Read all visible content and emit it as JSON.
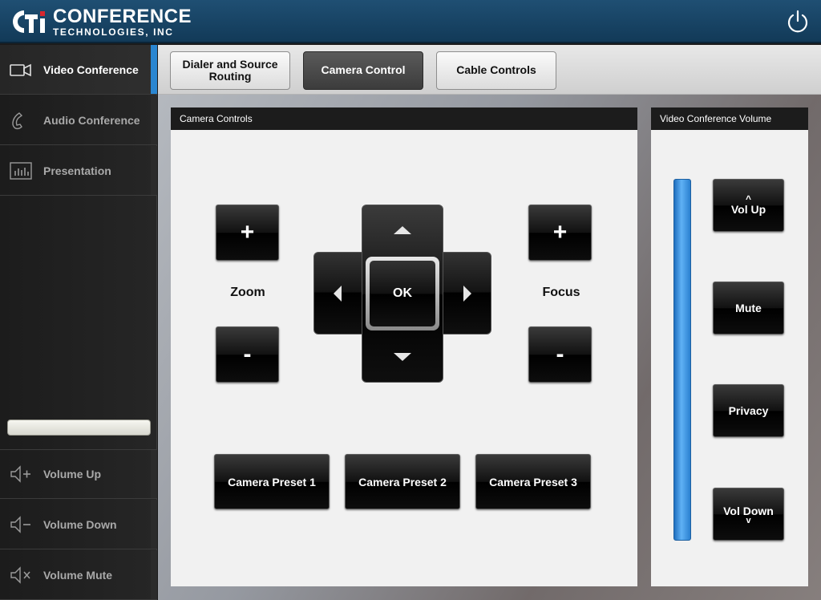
{
  "header": {
    "logo_mark": "CTi",
    "logo_line1": "CONFERENCE",
    "logo_line2": "TECHNOLOGIES, INC"
  },
  "sidebar": {
    "items": [
      {
        "label": "Video Conference",
        "icon": "video-camera-icon",
        "active": true
      },
      {
        "label": "Audio Conference",
        "icon": "phone-handset-icon",
        "active": false
      },
      {
        "label": "Presentation",
        "icon": "presentation-chart-icon",
        "active": false
      },
      {
        "label": "Volume Up",
        "icon": "speaker-plus-icon",
        "active": false
      },
      {
        "label": "Volume Down",
        "icon": "speaker-minus-icon",
        "active": false
      },
      {
        "label": "Volume Mute",
        "icon": "speaker-mute-icon",
        "active": false
      }
    ]
  },
  "tabs": [
    {
      "label": "Dialer and Source Routing",
      "active": false
    },
    {
      "label": "Camera Control",
      "active": true
    },
    {
      "label": "Cable Controls",
      "active": false
    }
  ],
  "camera_panel": {
    "title": "Camera Controls",
    "zoom_label": "Zoom",
    "focus_label": "Focus",
    "plus": "+",
    "minus": "-",
    "ok_label": "OK",
    "presets": [
      "Camera Preset 1",
      "Camera Preset 2",
      "Camera Preset 3"
    ]
  },
  "volume_panel": {
    "title": "Video Conference Volume",
    "vol_up": "Vol Up",
    "mute": "Mute",
    "privacy": "Privacy",
    "vol_down": "Vol Down",
    "up_glyph": "^",
    "down_glyph": "v",
    "level": 1.0
  },
  "colors": {
    "accent": "#2a86d1",
    "header": "#1a4a6e"
  }
}
